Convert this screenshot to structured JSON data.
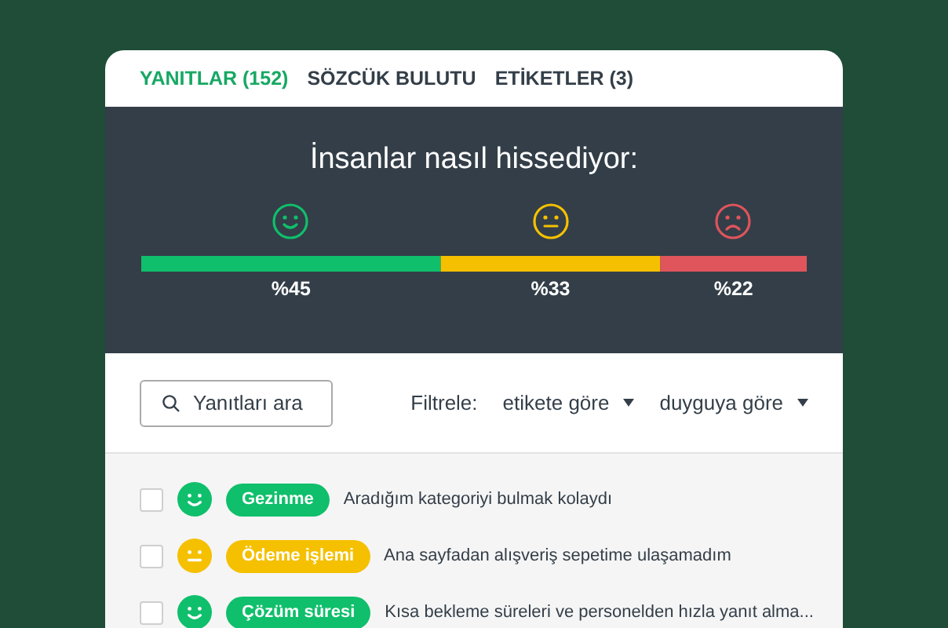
{
  "tabs": [
    {
      "label": "YANITLAR (152)",
      "selected": true
    },
    {
      "label": "SÖZCÜK BULUTU",
      "selected": false
    },
    {
      "label": "ETİKETLER (3)",
      "selected": false
    }
  ],
  "sentiment": {
    "title": "İnsanlar nasıl hissediyor:",
    "faces": [
      {
        "kind": "happy"
      },
      {
        "kind": "neutral"
      },
      {
        "kind": "sad"
      }
    ],
    "chart_data": {
      "type": "bar",
      "orientation": "horizontal",
      "stacked": true,
      "series": [
        {
          "color": "#0fbf6b",
          "values": [
            45
          ],
          "value_labels": [
            "%45"
          ]
        },
        {
          "color": "#f5c000",
          "values": [
            33
          ],
          "value_labels": [
            "%33"
          ]
        },
        {
          "color": "#e0545b",
          "values": [
            22
          ],
          "value_labels": [
            "%22"
          ]
        }
      ]
    }
  },
  "search": {
    "placeholder": "Yanıtları ara"
  },
  "filter": {
    "label": "Filtrele:",
    "dropdowns": [
      "etikete göre",
      "duyguya göre"
    ]
  },
  "responses": [
    {
      "checked": false,
      "kind": "happy",
      "tag": "Gezinme",
      "color": "#0fbf6b",
      "text": "Aradığım kategoriyi bulmak kolaydı"
    },
    {
      "checked": false,
      "kind": "neutral",
      "tag": "Ödeme işlemi",
      "color": "#f5c000",
      "text": "Ana sayfadan alışveriş sepetime ulaşamadım"
    },
    {
      "checked": false,
      "kind": "happy",
      "tag": "Çözüm süresi",
      "color": "#0fbf6b",
      "text": "Kısa bekleme süreleri ve personelden hızla yanıt alma..."
    }
  ]
}
